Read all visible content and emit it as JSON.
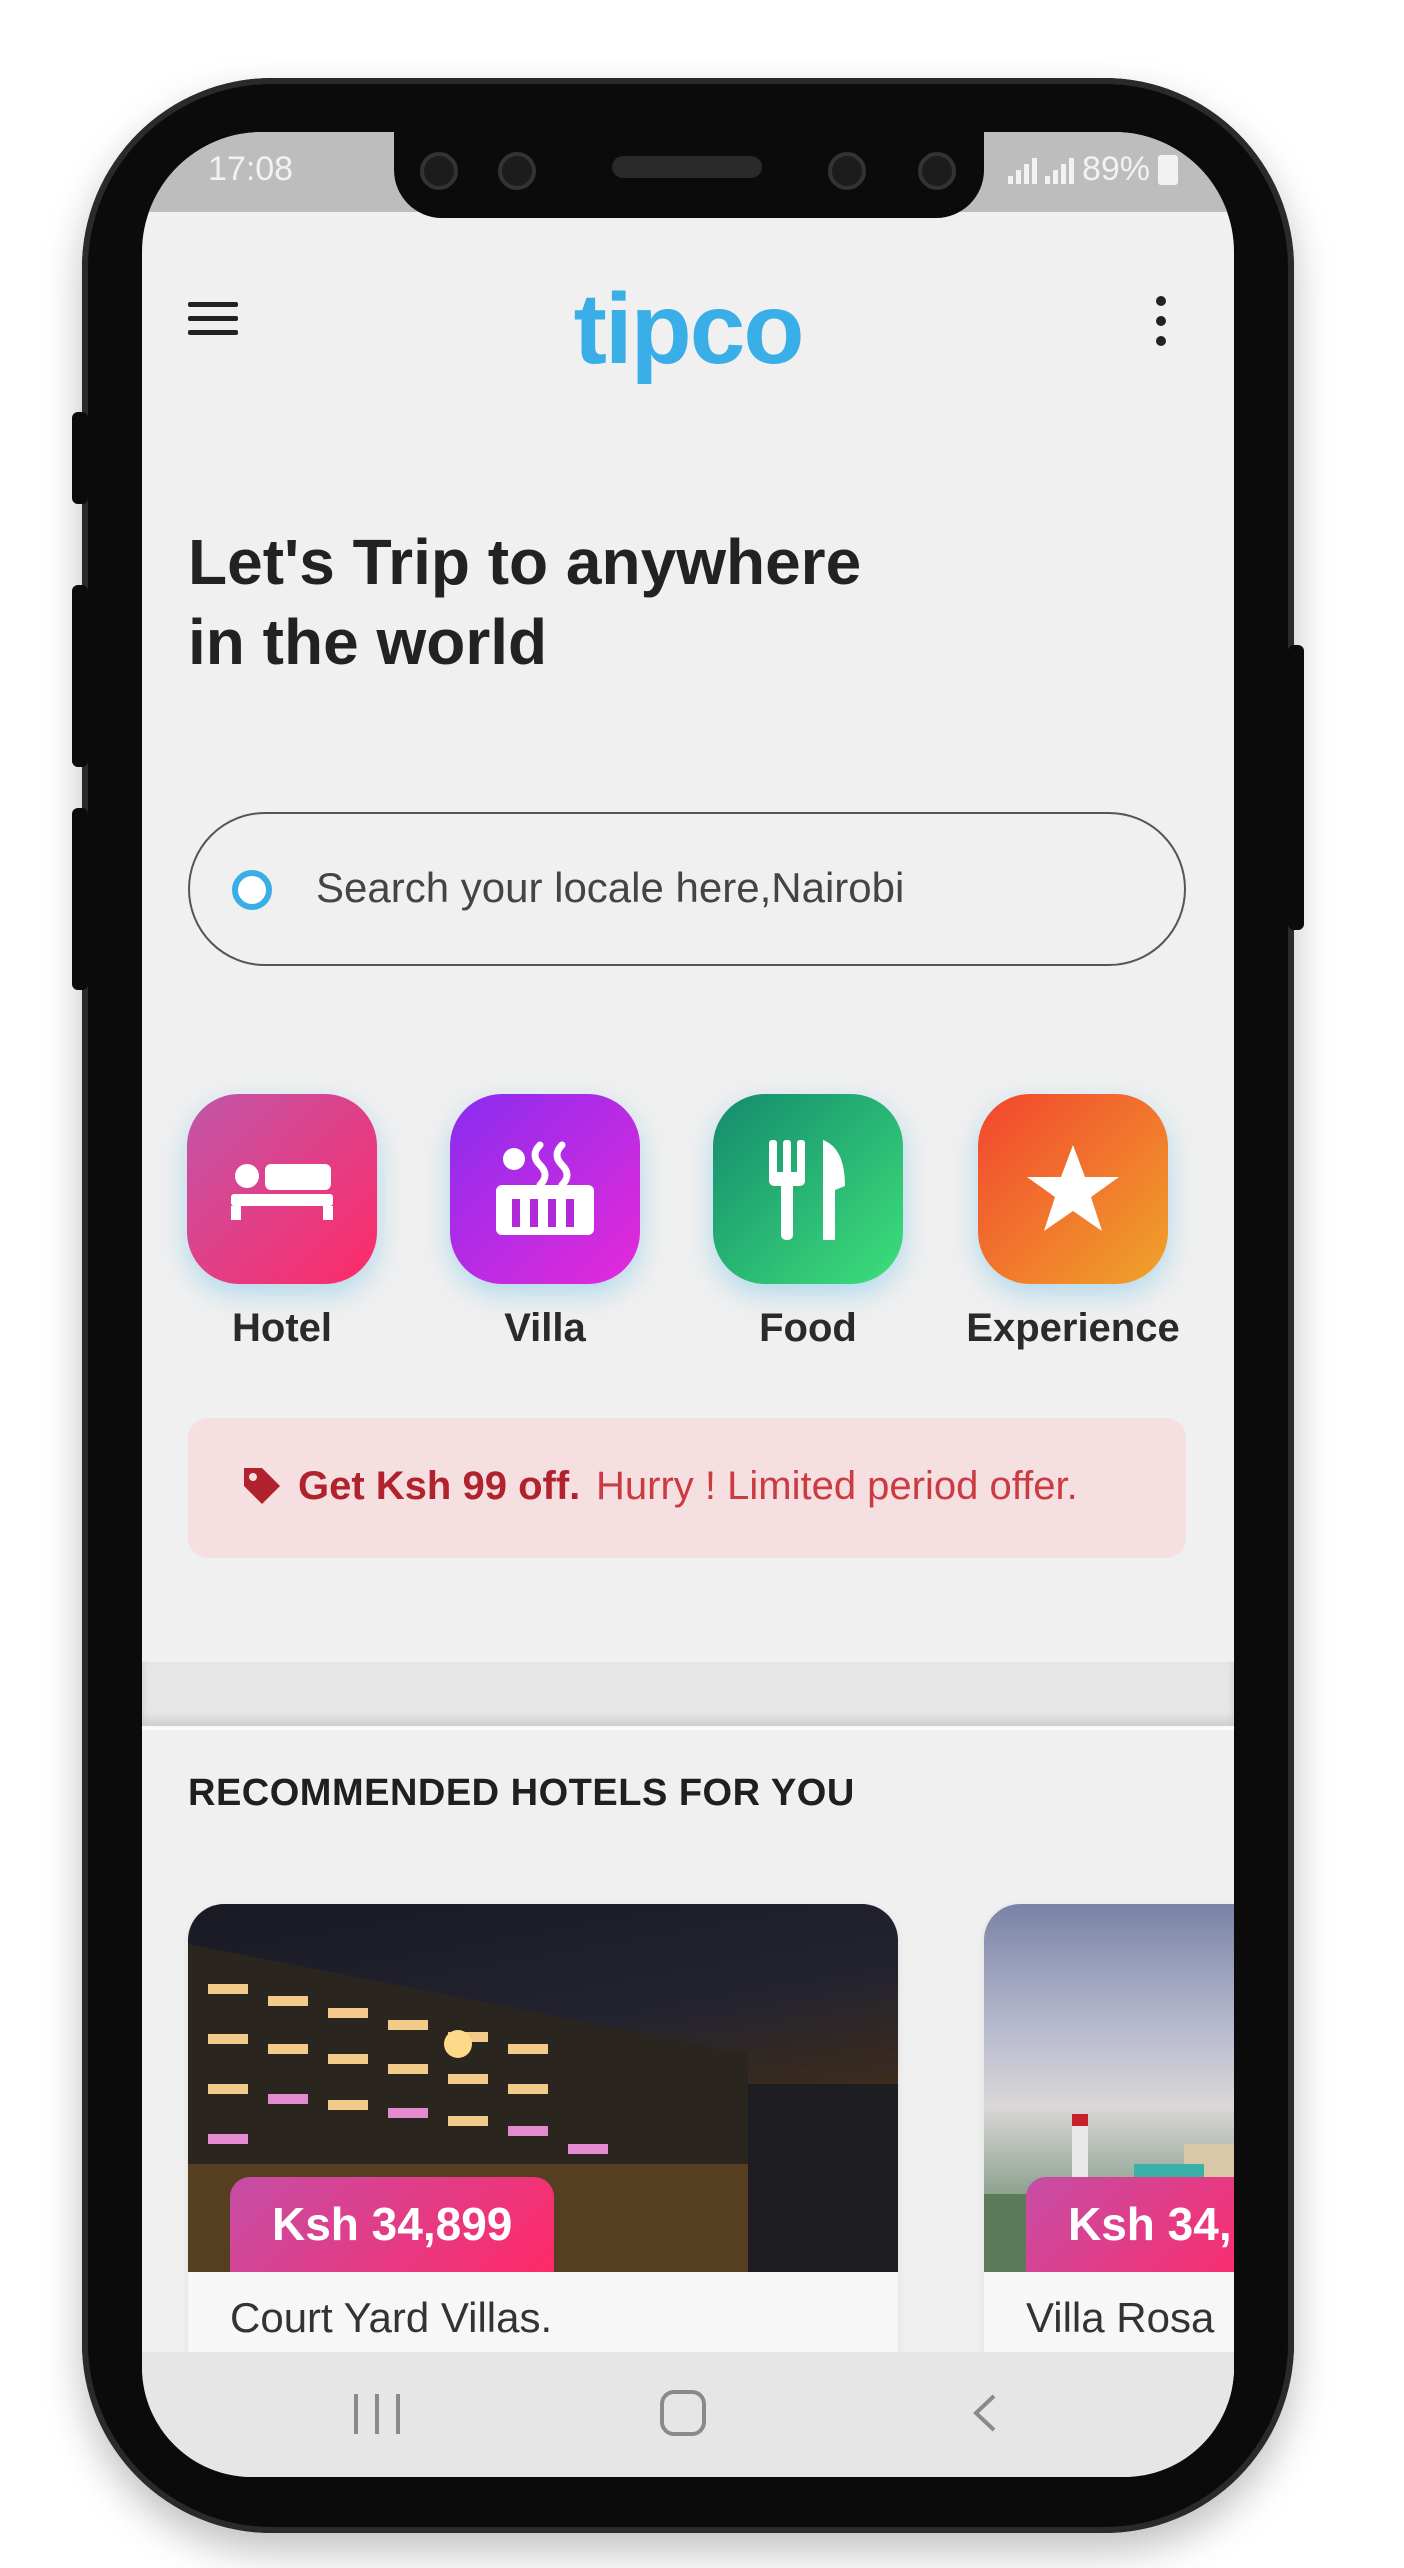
{
  "status_bar": {
    "time": "17:08",
    "battery": "89%"
  },
  "app": {
    "logo": "tipco"
  },
  "headline": {
    "line1": "Let's Trip to anywhere",
    "line2": "in the world"
  },
  "search": {
    "placeholder": "Search your locale here,Nairobi"
  },
  "categories": [
    {
      "label": "Hotel",
      "icon": "bed-icon"
    },
    {
      "label": "Villa",
      "icon": "hot-tub-icon"
    },
    {
      "label": "Food",
      "icon": "fork-knife-icon"
    },
    {
      "label": "Experience",
      "icon": "star-icon"
    }
  ],
  "offer": {
    "bold": "Get Ksh 99 off.",
    "rest": "Hurry ! Limited period offer.",
    "icon": "tag-icon"
  },
  "section": {
    "title": "RECOMMENDED HOTELS FOR YOU"
  },
  "hotels": [
    {
      "price": "Ksh 34,899",
      "name": "Court Yard Villas."
    },
    {
      "price": "Ksh 34,",
      "name": "Villa Rosa"
    }
  ],
  "colors": {
    "accent": "#3aaee6",
    "offer_bg": "#f5dfe0",
    "offer_text": "#b0222c"
  }
}
